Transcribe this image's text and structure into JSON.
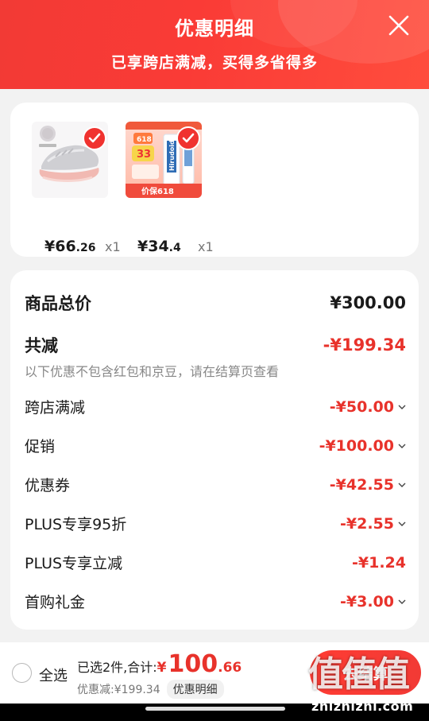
{
  "header": {
    "title": "优惠明细",
    "subtitle": "已享跨店满减，买得多省得多",
    "close_icon": "close-icon"
  },
  "products": [
    {
      "price_int": "¥66",
      "price_dec": ".26",
      "qty": "x1",
      "selected": true,
      "image": "sneaker-image"
    },
    {
      "price_int": "¥34",
      "price_dec": ".4",
      "qty": "x1",
      "selected": true,
      "image": "skincare-product-image",
      "image_texts": [
        "618",
        "Hirudoid",
        "价保618",
        "33"
      ]
    }
  ],
  "details": {
    "total_label": "商品总价",
    "total_value": "¥300.00",
    "reduce_label": "共减",
    "reduce_value": "-¥199.34",
    "note": "以下优惠不包含红包和京豆，请在结算页查看",
    "items": [
      {
        "label": "跨店满减",
        "value": "-¥50.00",
        "expandable": true
      },
      {
        "label": "促销",
        "value": "-¥100.00",
        "expandable": true
      },
      {
        "label": "优惠券",
        "value": "-¥42.55",
        "expandable": true
      },
      {
        "label": "PLUS专享95折",
        "value": "-¥2.55",
        "expandable": true
      },
      {
        "label": "PLUS专享立减",
        "value": "-¥1.24",
        "expandable": false
      },
      {
        "label": "首购礼金",
        "value": "-¥3.00",
        "expandable": true
      }
    ]
  },
  "bottom": {
    "select_all": "全选",
    "selected_text": "已选2件,合计:",
    "total_yen": "¥",
    "total_int": "100",
    "total_dec": ".66",
    "discount_text": "优惠减:¥199.34",
    "detail_link": "优惠明细",
    "checkout": "去结算"
  },
  "watermark": {
    "logo": "值值值",
    "url": "zhizhizhi.com"
  },
  "colors": {
    "accent": "#f23a35",
    "price_red": "#e8322b"
  }
}
